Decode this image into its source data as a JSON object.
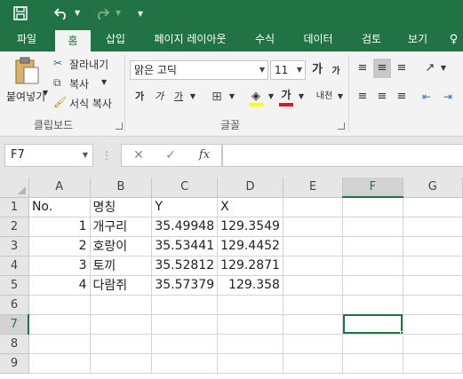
{
  "qat": {
    "save_icon": "save-icon",
    "undo_icon": "undo-icon",
    "redo_icon": "redo-icon",
    "customize_icon": "customize-qat-icon"
  },
  "tabs": [
    {
      "label": "파일"
    },
    {
      "label": "홈",
      "active": true
    },
    {
      "label": "삽입"
    },
    {
      "label": "페이지 레이아웃"
    },
    {
      "label": "수식"
    },
    {
      "label": "데이터"
    },
    {
      "label": "검토"
    },
    {
      "label": "보기"
    }
  ],
  "ribbon": {
    "clipboard": {
      "paste_label": "붙여넣기",
      "cut_label": "잘라내기",
      "copy_label": "복사",
      "format_painter_label": "서식 복사",
      "group_label": "클립보드"
    },
    "font": {
      "font_name": "맑은 고딕",
      "font_size": "11",
      "grow_label": "가",
      "shrink_label": "가",
      "bold_label": "가",
      "italic_label": "가",
      "underline_label": "가",
      "font_color_label": "가",
      "phonetic_label": "내천",
      "group_label": "글꼴",
      "fill_color": "#ffff00",
      "text_color": "#e81123"
    }
  },
  "formula_bar": {
    "name_box": "F7",
    "fx_label": "fx",
    "formula": ""
  },
  "sheet": {
    "columns": [
      "A",
      "B",
      "C",
      "D",
      "E",
      "F",
      "G"
    ],
    "selected_column": "F",
    "selected_row": "7",
    "rows": [
      {
        "num": "1",
        "cells": [
          "No.",
          "명칭",
          "Y",
          "X",
          "",
          "",
          ""
        ]
      },
      {
        "num": "2",
        "cells": [
          "1",
          "개구리",
          "35.49948",
          "129.3549",
          "",
          "",
          ""
        ]
      },
      {
        "num": "3",
        "cells": [
          "2",
          "호랑이",
          "35.53441",
          "129.4452",
          "",
          "",
          ""
        ]
      },
      {
        "num": "4",
        "cells": [
          "3",
          "토끼",
          "35.52812",
          "129.2871",
          "",
          "",
          ""
        ]
      },
      {
        "num": "5",
        "cells": [
          "4",
          "다람쥐",
          "35.57379",
          "129.358",
          "",
          "",
          ""
        ]
      },
      {
        "num": "6",
        "cells": [
          "",
          "",
          "",
          "",
          "",
          "",
          ""
        ]
      },
      {
        "num": "7",
        "cells": [
          "",
          "",
          "",
          "",
          "",
          "",
          ""
        ]
      },
      {
        "num": "8",
        "cells": [
          "",
          "",
          "",
          "",
          "",
          "",
          ""
        ]
      },
      {
        "num": "9",
        "cells": [
          "",
          "",
          "",
          "",
          "",
          "",
          ""
        ]
      }
    ]
  },
  "colors": {
    "accent": "#217346",
    "ribbon_bg": "#f3f3f3",
    "header_bg": "#e6e6e6"
  }
}
